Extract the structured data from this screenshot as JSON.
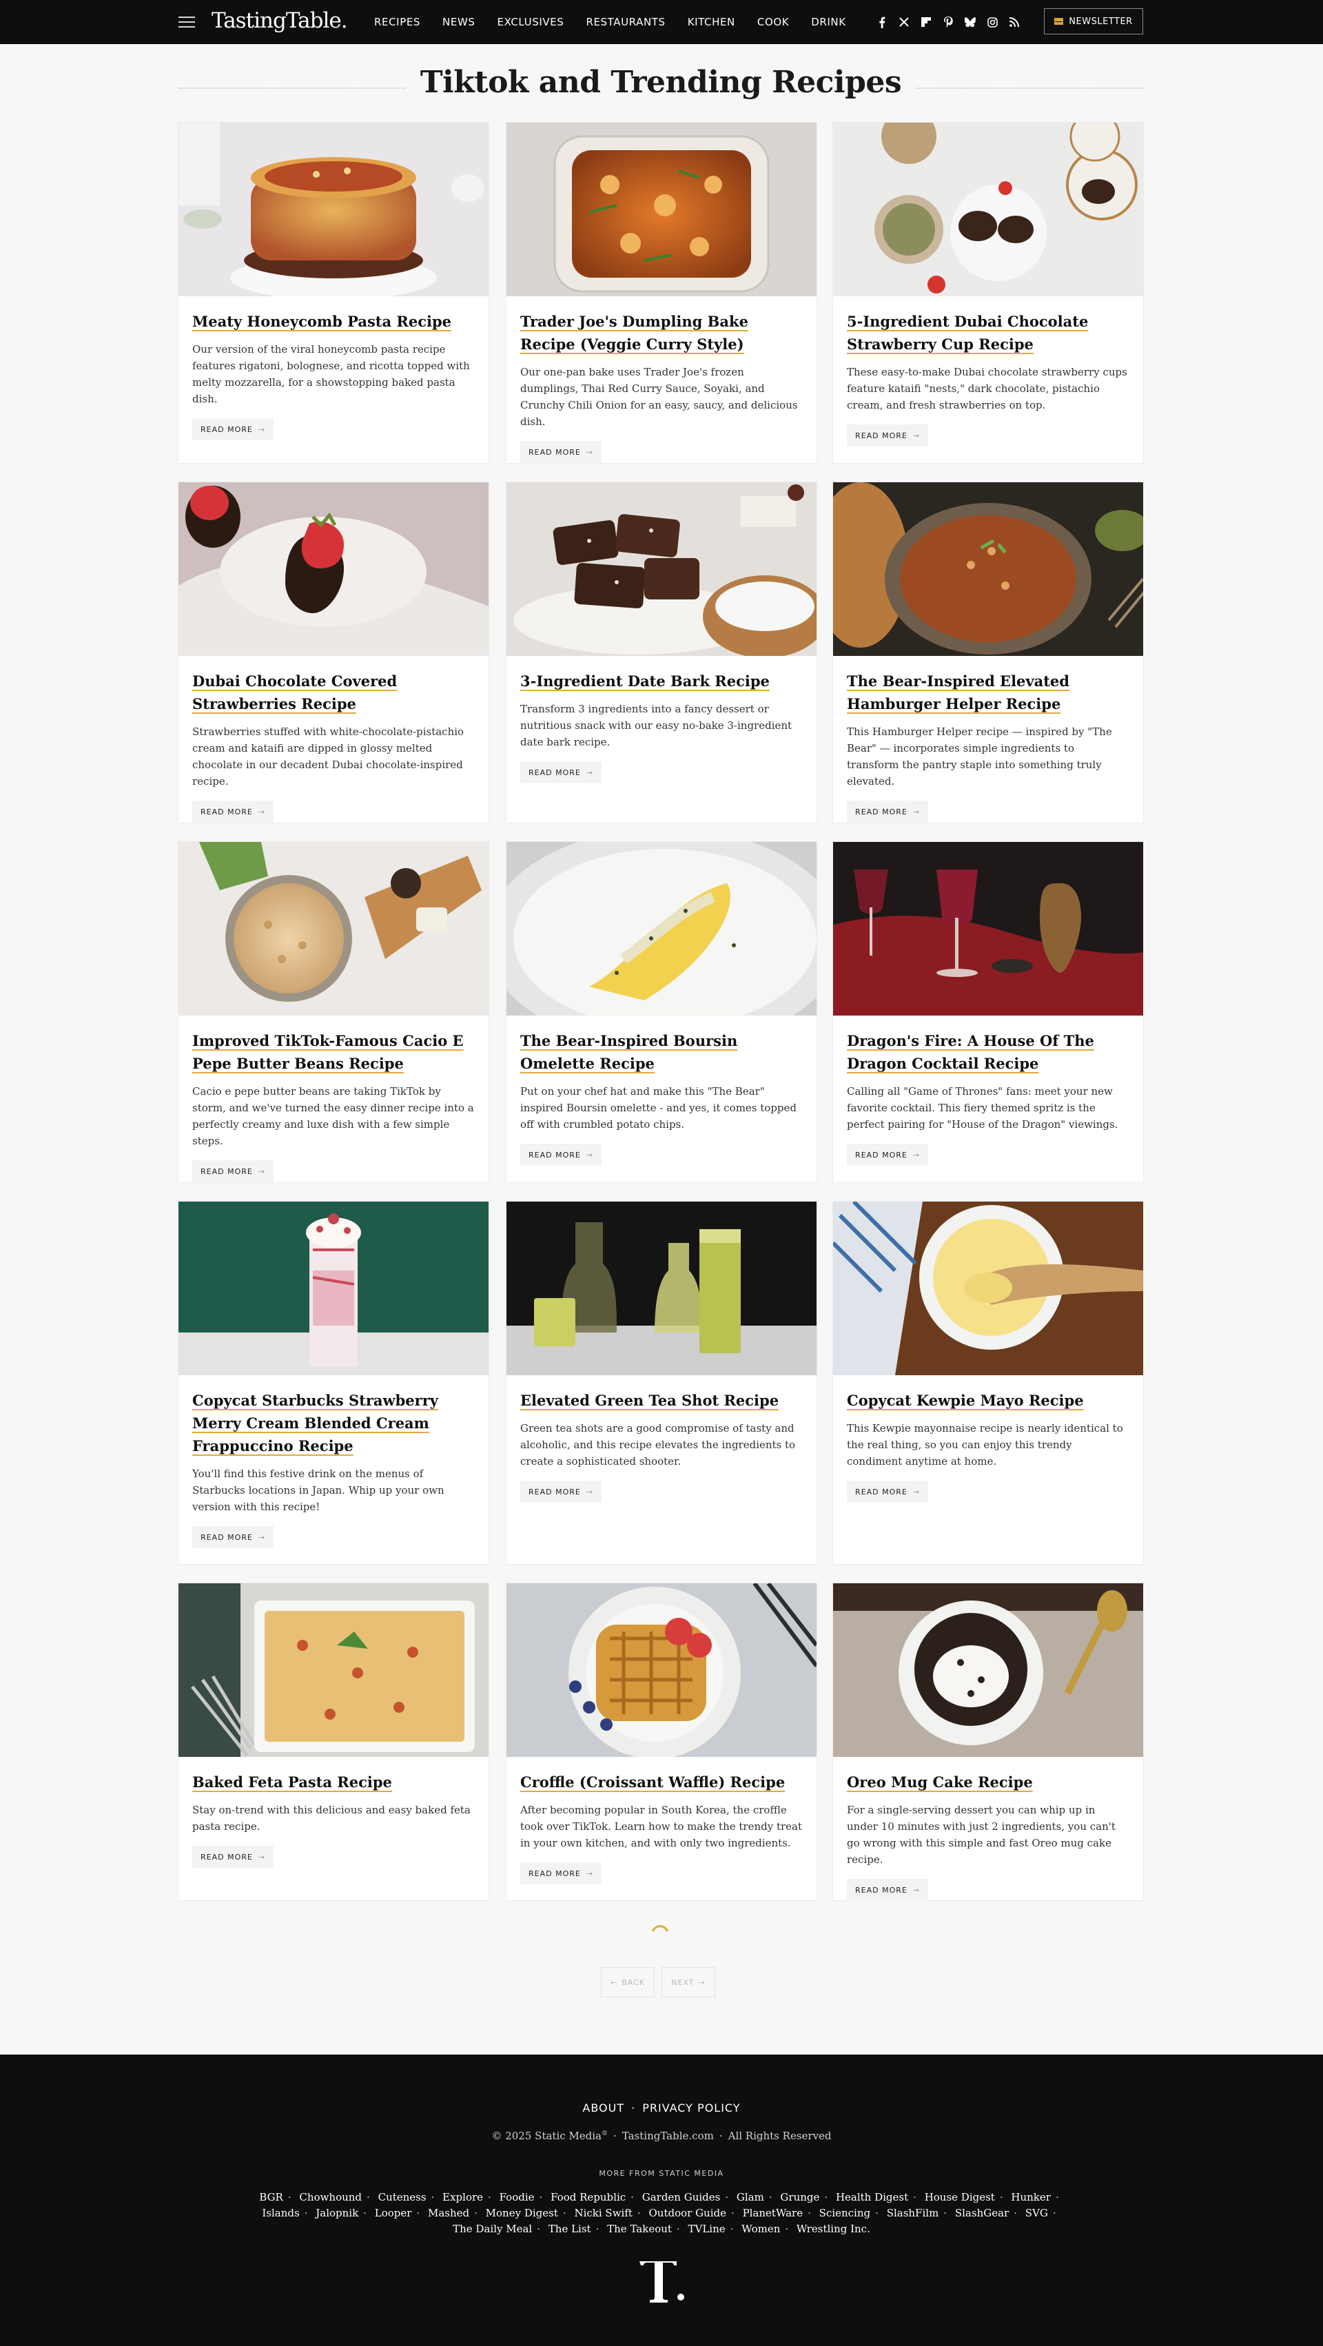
{
  "header": {
    "logo": "TastingTable.",
    "nav": [
      "RECIPES",
      "NEWS",
      "EXCLUSIVES",
      "RESTAURANTS",
      "KITCHEN",
      "COOK",
      "DRINK"
    ],
    "social_icons": [
      "facebook-icon",
      "x-icon",
      "flipboard-icon",
      "pinterest-icon",
      "bluesky-icon",
      "instagram-icon",
      "rss-icon"
    ],
    "newsletter_label": "NEWSLETTER"
  },
  "page_title": "Tiktok and Trending Recipes",
  "read_more_label": "READ MORE",
  "cards": [
    {
      "title": "Meaty Honeycomb Pasta Recipe",
      "desc": "Our version of the viral honeycomb pasta recipe features rigatoni, bolognese, and ricotta topped with melty mozzarella, for a showstopping baked pasta dish."
    },
    {
      "title": "Trader Joe's Dumpling Bake Recipe (Veggie Curry Style)",
      "desc": "Our one-pan bake uses Trader Joe's frozen dumplings, Thai Red Curry Sauce, Soyaki, and Crunchy Chili Onion for an easy, saucy, and delicious dish."
    },
    {
      "title": "5-Ingredient Dubai Chocolate Strawberry Cup Recipe",
      "desc": "These easy-to-make Dubai chocolate strawberry cups feature kataifi \"nests,\" dark chocolate, pistachio cream, and fresh strawberries on top."
    },
    {
      "title": "Dubai Chocolate Covered Strawberries Recipe",
      "desc": "Strawberries stuffed with white-chocolate-pistachio cream and kataifi are dipped in glossy melted chocolate in our decadent Dubai chocolate-inspired recipe."
    },
    {
      "title": "3-Ingredient Date Bark Recipe",
      "desc": "Transform 3 ingredients into a fancy dessert or nutritious snack with our easy no-bake 3-ingredient date bark recipe."
    },
    {
      "title": "The Bear-Inspired Elevated Hamburger Helper Recipe",
      "desc": "This Hamburger Helper recipe — inspired by \"The Bear\" — incorporates simple ingredients to transform the pantry staple into something truly elevated."
    },
    {
      "title": "Improved TikTok-Famous Cacio E Pepe Butter Beans Recipe",
      "desc": "Cacio e pepe butter beans are taking TikTok by storm, and we've turned the easy dinner recipe into a perfectly creamy and luxe dish with a few simple steps."
    },
    {
      "title": "The Bear-Inspired Boursin Omelette Recipe",
      "desc": "Put on your chef hat and make this \"The Bear\" inspired Boursin omelette - and yes, it comes topped off with crumbled potato chips."
    },
    {
      "title": "Dragon's Fire: A House Of The Dragon Cocktail Recipe",
      "desc": "Calling all \"Game of Thrones\" fans: meet your new favorite cocktail. This fiery themed spritz is the perfect pairing for \"House of the Dragon\" viewings."
    },
    {
      "title": "Copycat Starbucks Strawberry Merry Cream Blended Cream Frappuccino Recipe",
      "desc": "You'll find this festive drink on the menus of Starbucks locations in Japan. Whip up your own version with this recipe!"
    },
    {
      "title": "Elevated Green Tea Shot Recipe",
      "desc": "Green tea shots are a good compromise of tasty and alcoholic, and this recipe elevates the ingredients to create a sophisticated shooter."
    },
    {
      "title": "Copycat Kewpie Mayo Recipe",
      "desc": "This Kewpie mayonnaise recipe is nearly identical to the real thing, so you can enjoy this trendy condiment anytime at home."
    },
    {
      "title": "Baked Feta Pasta Recipe",
      "desc": "Stay on-trend with this delicious and easy baked feta pasta recipe."
    },
    {
      "title": "Croffle (Croissant Waffle) Recipe",
      "desc": "After becoming popular in South Korea, the croffle took over TikTok. Learn how to make the trendy treat in your own kitchen, and with only two ingredients."
    },
    {
      "title": "Oreo Mug Cake Recipe",
      "desc": "For a single-serving dessert you can whip up in under 10 minutes with just 2 ingredients, you can't go wrong with this simple and fast Oreo mug cake recipe."
    }
  ],
  "pagination": {
    "back": "BACK",
    "next": "NEXT"
  },
  "footer": {
    "links": [
      "ABOUT",
      "PRIVACY POLICY"
    ],
    "copyright": [
      "© 2025 Static Media",
      "TastingTable.com",
      "All Rights Reserved"
    ],
    "more_title": "MORE FROM STATIC MEDIA",
    "network": [
      "BGR",
      "Chowhound",
      "Cuteness",
      "Explore",
      "Foodie",
      "Food Republic",
      "Garden Guides",
      "Glam",
      "Grunge",
      "Health Digest",
      "House Digest",
      "Hunker",
      "Islands",
      "Jalopnik",
      "Looper",
      "Mashed",
      "Money Digest",
      "Nicki Swift",
      "Outdoor Guide",
      "PlanetWare",
      "Sciencing",
      "SlashFilm",
      "SlashGear",
      "SVG",
      "The Daily Meal",
      "The List",
      "The Takeout",
      "TVLine",
      "Women",
      "Wrestling Inc."
    ],
    "logo": "T."
  }
}
